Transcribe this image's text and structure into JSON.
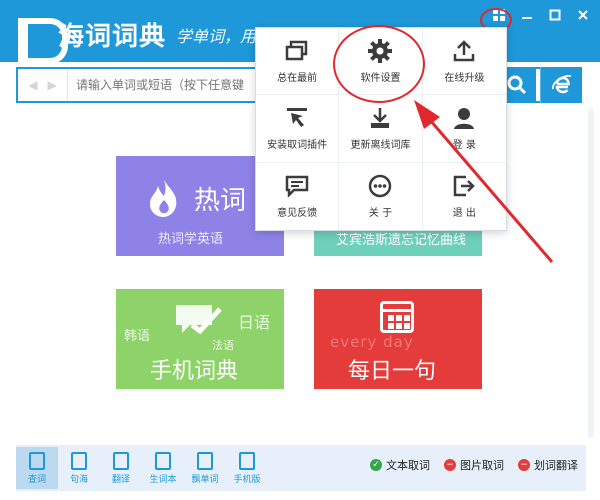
{
  "app": {
    "name": "海词词典",
    "slogan": "学单词，用"
  },
  "search": {
    "placeholder": "请输入单词或短语（按下任意键"
  },
  "menu": {
    "items": [
      {
        "label": "总在最前",
        "icon": "window-icon"
      },
      {
        "label": "软件设置",
        "icon": "gear-icon"
      },
      {
        "label": "在线升级",
        "icon": "upload-icon"
      },
      {
        "label": "安装取词插件",
        "icon": "cursor-icon"
      },
      {
        "label": "更新离线词库",
        "icon": "download-icon"
      },
      {
        "label": "登 录",
        "icon": "user-icon"
      },
      {
        "label": "意见反馈",
        "icon": "comment-icon"
      },
      {
        "label": "关 于",
        "icon": "info-dots-icon"
      },
      {
        "label": "退 出",
        "icon": "exit-icon"
      }
    ]
  },
  "tiles": {
    "hot": {
      "title": "热词",
      "sub": "热词学英语"
    },
    "ebbinghaus": {
      "sub": "艾宾浩斯遗忘记忆曲线"
    },
    "mobile": {
      "title": "手机词典",
      "tag_korean": "韩语",
      "tag_japanese": "日语",
      "tag_french": "法语"
    },
    "daily": {
      "title": "每日一句",
      "bg_text": "every day"
    }
  },
  "bottombar": {
    "items": [
      {
        "label": "查词",
        "icon": "lookup-icon"
      },
      {
        "label": "句海",
        "icon": "sentence-icon"
      },
      {
        "label": "翻译",
        "icon": "translate-icon"
      },
      {
        "label": "生词本",
        "icon": "wordbook-icon"
      },
      {
        "label": "飘单词",
        "icon": "floating-words-icon"
      },
      {
        "label": "手机版",
        "icon": "mobile-icon"
      }
    ],
    "toggles": [
      {
        "label": "文本取词",
        "state": "on"
      },
      {
        "label": "图片取词",
        "state": "off"
      },
      {
        "label": "划词翻译",
        "state": "off"
      }
    ]
  },
  "colors": {
    "primary": "#1e98d8",
    "highlight": "#e0282e"
  }
}
